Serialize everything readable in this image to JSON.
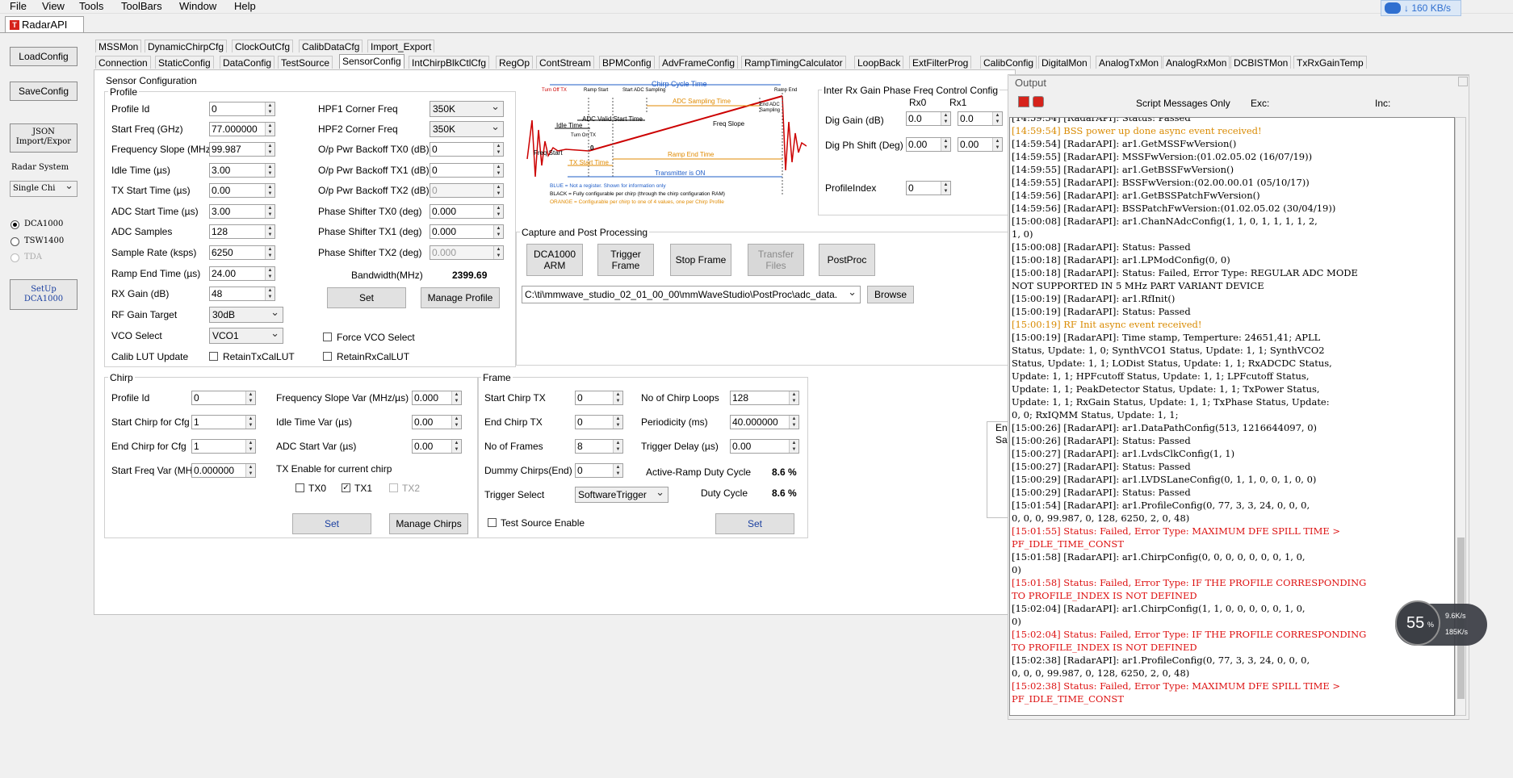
{
  "menu": [
    "File",
    "View",
    "Tools",
    "ToolBars",
    "Window",
    "Help"
  ],
  "speed_badge": "↓ 160 KB/s",
  "app_tab": "RadarAPI",
  "left": {
    "load_config": "LoadConfig",
    "save_config": "SaveConfig",
    "json_line1": "JSON",
    "json_line2": "Import/Expor",
    "radar_system_label": "Radar System",
    "radar_system_value": "Single Chi",
    "dca1000": "DCA1000",
    "tsw1400": "TSW1400",
    "tda": "TDA",
    "setup_line1": "SetUp",
    "setup_line2": "DCA1000"
  },
  "tabs_row1": [
    "MSSMon",
    "DynamicChirpCfg",
    "ClockOutCfg",
    "CalibDataCfg",
    "Import_Export"
  ],
  "tabs_row2": [
    "Connection",
    "StaticConfig",
    "DataConfig",
    "TestSource",
    "SensorConfig",
    "IntChirpBlkCtlCfg",
    "RegOp",
    "ContStream",
    "BPMConfig",
    "AdvFrameConfig",
    "RampTimingCalculator",
    "LoopBack",
    "ExtFilterProg",
    "CalibConfig",
    "DigitalMon",
    "AnalogTxMon",
    "AnalogRxMon",
    "DCBISTMon",
    "TxRxGainTemp"
  ],
  "sensor": {
    "title": "Sensor Configuration",
    "profile_title": "Profile",
    "profile_labels": [
      "Profile Id",
      "Start Freq (GHz)",
      "Frequency Slope (MHz/µs)",
      "Idle Time (µs)",
      "TX Start Time (µs)",
      "ADC Start Time (µs)",
      "ADC Samples",
      "Sample Rate (ksps)",
      "Ramp End Time (µs)",
      "RX Gain (dB)",
      "RF Gain Target",
      "VCO Select",
      "Calib LUT Update"
    ],
    "profile_values": [
      "0",
      "77.000000",
      "99.987",
      "3.00",
      "0.00",
      "3.00",
      "128",
      "6250",
      "24.00",
      "48"
    ],
    "rf_gain_target": "30dB",
    "vco_select": "VCO1",
    "right_labels": [
      "HPF1 Corner Freq",
      "HPF2 Corner Freq",
      "O/p Pwr Backoff TX0 (dB)",
      "O/p Pwr Backoff TX1 (dB)",
      "O/p Pwr Backoff TX2 (dB)",
      "Phase Shifter TX0 (deg)",
      "Phase Shifter TX1 (deg)",
      "Phase Shifter TX2 (deg)"
    ],
    "hpf1": "350K",
    "hpf2": "350K",
    "right_values": [
      "0",
      "0",
      "0",
      "0.000",
      "0.000",
      "0.000"
    ],
    "bandwidth_label": "Bandwidth(MHz)",
    "bandwidth_value": "2399.69",
    "set": "Set",
    "manage_profile": "Manage Profile",
    "force_vco": "Force VCO Select",
    "retain_tx": "RetainTxCalLUT",
    "retain_rx": "RetainRxCalLUT"
  },
  "diagram": {
    "chirp_cycle": "Chirp Cycle Time",
    "turn_off_tx": "Turn Off TX",
    "ramp_start": "Ramp Start",
    "start_adc": "Start ADC Sampling",
    "ramp_end": "Ramp End",
    "adc_valid": "ADC Valid Start Time",
    "adc_sampling": "ADC Sampling Time",
    "end_adc": "End ADC Sampling",
    "idle_time": "Idle Time",
    "turn_on_tx": "Turn On TX",
    "freq_slope": "Freq Slope",
    "freq_start": "Freq Start",
    "ramp_end_time": "Ramp End Time",
    "tx_start_time": "TX Start Time",
    "transmitter_on": "Transmitter is ON",
    "zero": "0",
    "legend_blue": "BLUE = Not a register. Shown for information only",
    "legend_black": "BLACK = Fully configurable per chirp (through the chirp configuration RAM)",
    "legend_orange": "ORANGE = Configurable per chirp to one of 4 values, one per Chirp Profile"
  },
  "inter_rx": {
    "title": "Inter Rx Gain Phase Freq Control Config",
    "rx0": "Rx0",
    "rx1": "Rx1",
    "dig_gain": "Dig Gain (dB)",
    "dig_ph": "Dig Ph Shift (Deg)",
    "gain_vals": [
      "0.0",
      "0.0"
    ],
    "ph_vals": [
      "0.00",
      "0.00"
    ],
    "profile_index": "ProfileIndex",
    "profile_index_value": "0"
  },
  "capture": {
    "title": "Capture and Post Processing",
    "dca_arm_1": "DCA1000",
    "dca_arm_2": "ARM",
    "trigger_1": "Trigger",
    "trigger_2": "Frame",
    "stop_frame": "Stop Frame",
    "transfer_1": "Transfer",
    "transfer_2": "Files",
    "postproc": "PostProc",
    "path": "C:\\ti\\mmwave_studio_02_01_00_00\\mmWaveStudio\\PostProc\\adc_data.",
    "browse": "Browse"
  },
  "chirp": {
    "title": "Chirp",
    "left_labels": [
      "Profile Id",
      "Start Chirp for Cfg",
      "End Chirp for Cfg",
      "Start Freq Var (MHz)"
    ],
    "left_values": [
      "0",
      "1",
      "1",
      "0.000000"
    ],
    "right_labels": [
      "Frequency Slope Var (MHz/µs)",
      "Idle Time Var (µs)",
      "ADC Start Var (µs)"
    ],
    "right_values": [
      "0.000",
      "0.00",
      "0.00"
    ],
    "tx_enable": "TX Enable for current chirp",
    "tx0": "TX0",
    "tx1": "TX1",
    "tx2": "TX2",
    "set": "Set",
    "manage": "Manage Chirps"
  },
  "frame": {
    "title": "Frame",
    "left_labels": [
      "Start Chirp TX",
      "End Chirp TX",
      "No of Frames",
      "Dummy Chirps(End)",
      "Trigger Select"
    ],
    "left_values": [
      "0",
      "0",
      "8",
      "0"
    ],
    "trigger_select": "SoftwareTrigger",
    "right_labels": [
      "No of Chirp Loops",
      "Periodicity (ms)",
      "Trigger Delay (µs)"
    ],
    "right_values": [
      "128",
      "40.000000",
      "0.00"
    ],
    "active_ramp": "Active-Ramp Duty Cycle",
    "active_ramp_value": "8.6 %",
    "duty_cycle": "Duty Cycle",
    "duty_cycle_value": "8.6 %",
    "test_source": "Test Source Enable",
    "set": "Set"
  },
  "output": {
    "title": "Output",
    "script_only": "Script Messages Only",
    "exc": "Exc:",
    "inc": "Inc:",
    "lines": [
      {
        "t": "[14:59:54]  [RadarAPI]: Status: Passed",
        "c": "black"
      },
      {
        "t": "[14:59:54]  BSS power up done async event received!",
        "c": "orange"
      },
      {
        "t": "[14:59:54]  [RadarAPI]: ar1.GetMSSFwVersion()",
        "c": "black"
      },
      {
        "t": "[14:59:55]  [RadarAPI]: MSSFwVersion:(01.02.05.02 (16/07/19))",
        "c": "black"
      },
      {
        "t": "[14:59:55]  [RadarAPI]: ar1.GetBSSFwVersion()",
        "c": "black"
      },
      {
        "t": "[14:59:55]  [RadarAPI]: BSSFwVersion:(02.00.00.01 (05/10/17))",
        "c": "black"
      },
      {
        "t": "[14:59:56]  [RadarAPI]: ar1.GetBSSPatchFwVersion()",
        "c": "black"
      },
      {
        "t": "[14:59:56]  [RadarAPI]: BSSPatchFwVersion:(01.02.05.02 (30/04/19))",
        "c": "black"
      },
      {
        "t": "[15:00:08]  [RadarAPI]: ar1.ChanNAdcConfig(1, 1, 0, 1, 1, 1, 1, 2,",
        "c": "black"
      },
      {
        "t": "1, 0)",
        "c": "black"
      },
      {
        "t": "[15:00:08]  [RadarAPI]: Status: Passed",
        "c": "black"
      },
      {
        "t": "[15:00:18]  [RadarAPI]: ar1.LPModConfig(0, 0)",
        "c": "black"
      },
      {
        "t": "[15:00:18]  [RadarAPI]: Status: Failed, Error Type: REGULAR ADC MODE",
        "c": "black"
      },
      {
        "t": "NOT SUPPORTED IN 5 MHz PART VARIANT DEVICE",
        "c": "black"
      },
      {
        "t": "[15:00:19]  [RadarAPI]: ar1.RfInit()",
        "c": "black"
      },
      {
        "t": "[15:00:19]  [RadarAPI]: Status: Passed",
        "c": "black"
      },
      {
        "t": "[15:00:19]  RF Init async event received!",
        "c": "orange"
      },
      {
        "t": "[15:00:19]  [RadarAPI]: Time stamp, Temperture: 24651,41; APLL",
        "c": "black"
      },
      {
        "t": "Status, Update: 1, 0; SynthVCO1 Status, Update: 1, 1; SynthVCO2",
        "c": "black"
      },
      {
        "t": "Status, Update: 1, 1; LODist Status, Update: 1, 1; RxADCDC Status,",
        "c": "black"
      },
      {
        "t": "Update: 1, 1; HPFcutoff Status, Update: 1, 1; LPFcutoff Status,",
        "c": "black"
      },
      {
        "t": "Update: 1, 1; PeakDetector Status, Update: 1, 1; TxPower Status,",
        "c": "black"
      },
      {
        "t": "Update: 1, 1; RxGain Status, Update: 1, 1; TxPhase Status, Update:",
        "c": "black"
      },
      {
        "t": "0, 0; RxIQMM Status, Update: 1, 1;",
        "c": "black"
      },
      {
        "t": "[15:00:26]  [RadarAPI]: ar1.DataPathConfig(513, 1216644097, 0)",
        "c": "black"
      },
      {
        "t": "[15:00:26]  [RadarAPI]: Status: Passed",
        "c": "black"
      },
      {
        "t": "[15:00:27]  [RadarAPI]: ar1.LvdsClkConfig(1, 1)",
        "c": "black"
      },
      {
        "t": "[15:00:27]  [RadarAPI]: Status: Passed",
        "c": "black"
      },
      {
        "t": "[15:00:29]  [RadarAPI]: ar1.LVDSLaneConfig(0, 1, 1, 0, 0, 1, 0, 0)",
        "c": "black"
      },
      {
        "t": "[15:00:29]  [RadarAPI]: Status: Passed",
        "c": "black"
      },
      {
        "t": "[15:01:54]  [RadarAPI]: ar1.ProfileConfig(0, 77, 3, 3, 24, 0, 0, 0,",
        "c": "black"
      },
      {
        "t": "0, 0, 0, 99.987, 0, 128, 6250, 2, 0, 48)",
        "c": "black"
      },
      {
        "t": "[15:01:55]  Status: Failed, Error Type: MAXIMUM DFE SPILL TIME >",
        "c": "red"
      },
      {
        "t": "PF_IDLE_TIME_CONST",
        "c": "red"
      },
      {
        "t": "[15:01:58]  [RadarAPI]: ar1.ChirpConfig(0, 0, 0, 0, 0, 0, 0, 1, 0,",
        "c": "black"
      },
      {
        "t": "0)",
        "c": "black"
      },
      {
        "t": "[15:01:58]  Status: Failed, Error Type: IF THE PROFILE CORRESPONDING",
        "c": "red"
      },
      {
        "t": "TO PROFILE_INDEX IS NOT DEFINED",
        "c": "red"
      },
      {
        "t": "[15:02:04]  [RadarAPI]: ar1.ChirpConfig(1, 1, 0, 0, 0, 0, 0, 1, 0,",
        "c": "black"
      },
      {
        "t": "0)",
        "c": "black"
      },
      {
        "t": "[15:02:04]  Status: Failed, Error Type: IF THE PROFILE CORRESPONDING",
        "c": "red"
      },
      {
        "t": "TO PROFILE_INDEX IS NOT DEFINED",
        "c": "red"
      },
      {
        "t": "[15:02:38]  [RadarAPI]: ar1.ProfileConfig(0, 77, 3, 3, 24, 0, 0, 0,",
        "c": "black"
      },
      {
        "t": "0, 0, 0, 99.987, 0, 128, 6250, 2, 0, 48)",
        "c": "black"
      },
      {
        "t": "[15:02:38]  Status: Failed, Error Type: MAXIMUM DFE SPILL TIME >",
        "c": "red"
      },
      {
        "t": "PF_IDLE_TIME_CONST",
        "c": "red"
      }
    ]
  },
  "behind_panel": {
    "en": "En",
    "sa": "Sa"
  },
  "net_widget": {
    "percent": "55",
    "unit": "%",
    "up": "9.6",
    "up_unit": "K/s",
    "down": "185",
    "down_unit": "K/s"
  }
}
